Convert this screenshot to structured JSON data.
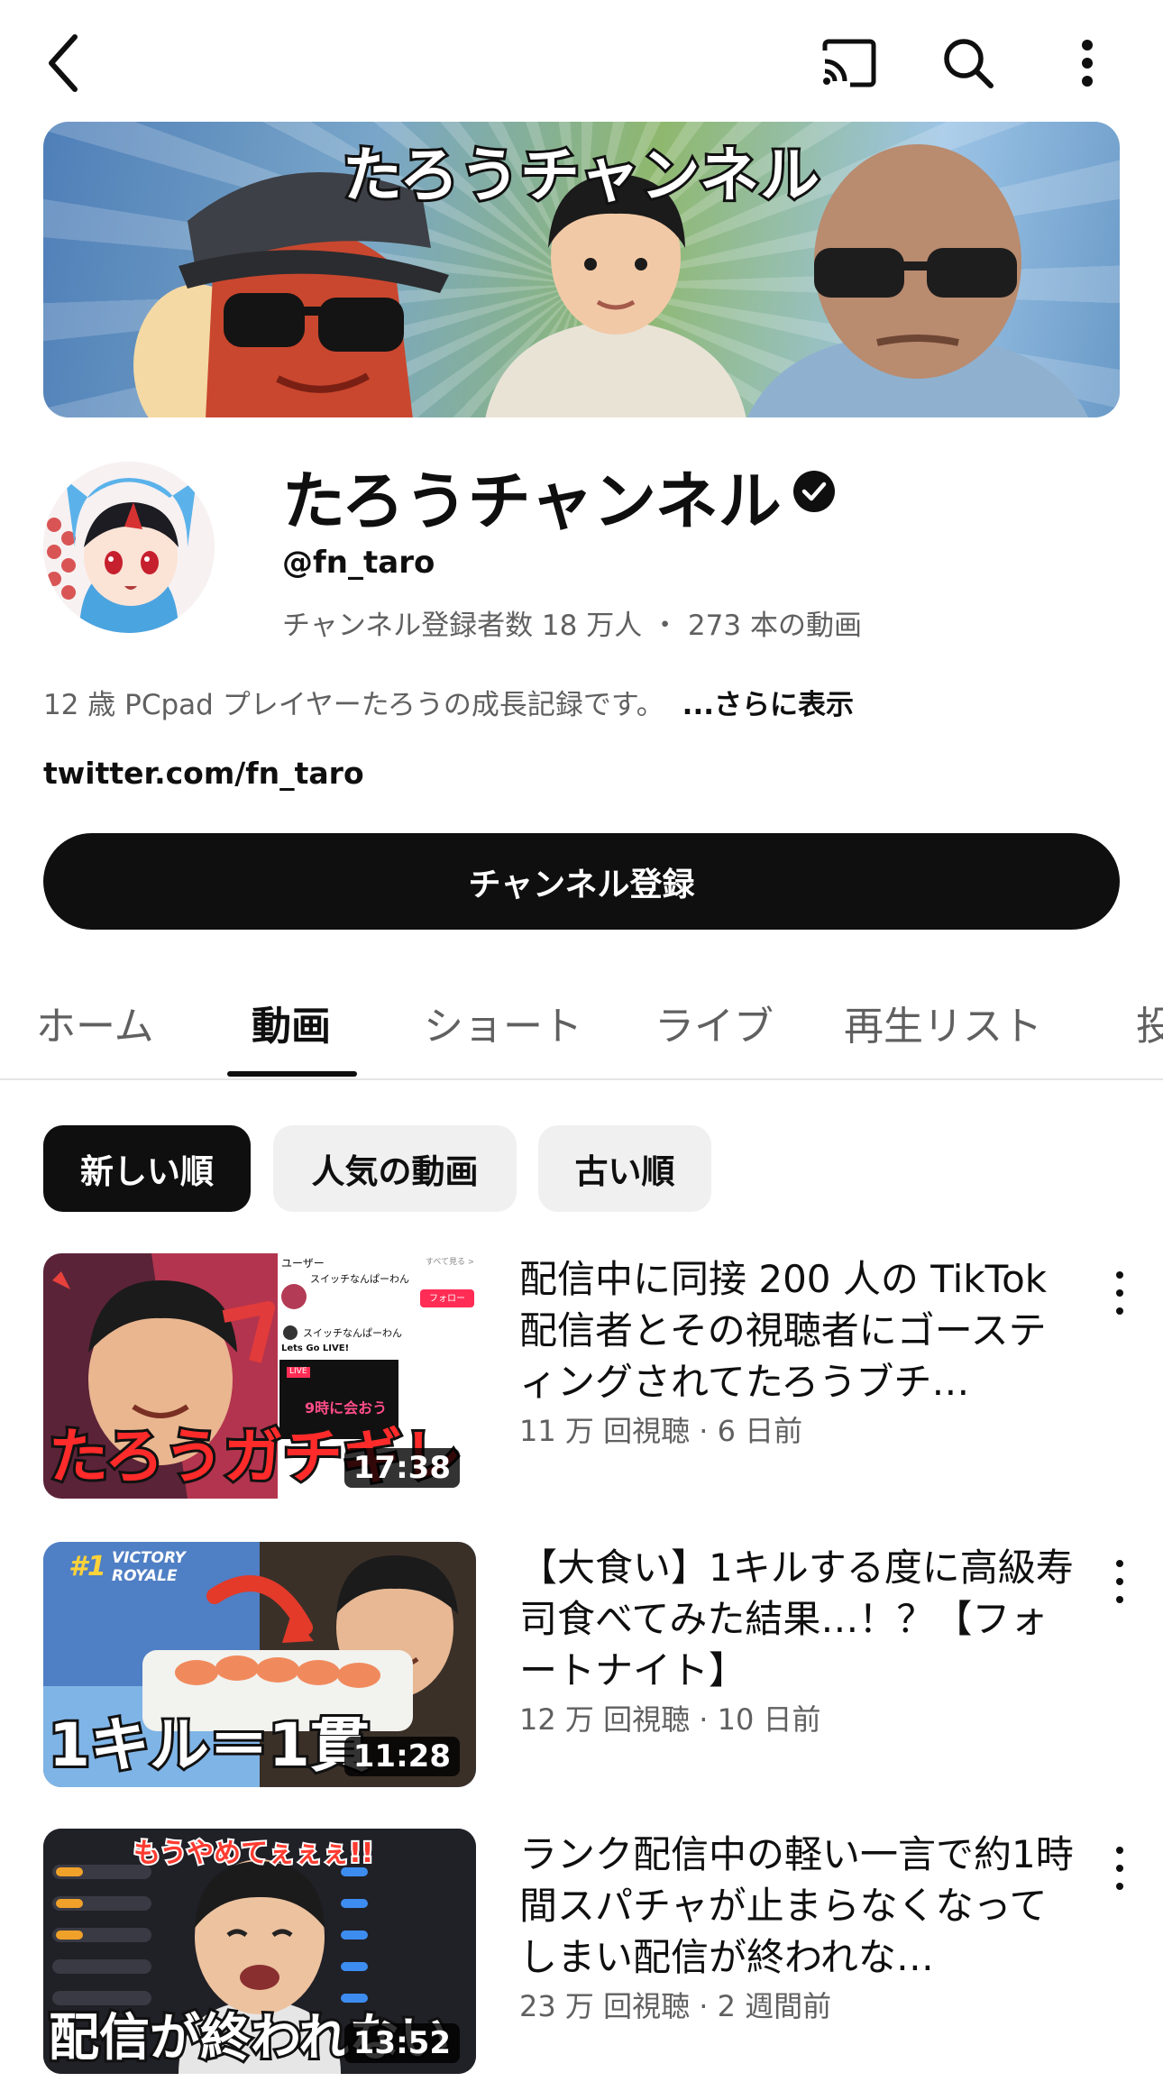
{
  "topbar": {
    "back_icon": "chevron-left-icon",
    "cast_icon": "cast-icon",
    "search_icon": "search-icon",
    "more_icon": "more-vert-icon"
  },
  "banner": {
    "title": "たろうチャンネル"
  },
  "channel": {
    "name": "たろうチャンネル",
    "handle": "@fn_taro",
    "stats": "チャンネル登録者数 18 万人 ・ 273 本の動画",
    "description": "12 歳 PCpad プレイヤーたろうの成長記録です。",
    "more_label": "...さらに表示",
    "link": "twitter.com/fn_taro",
    "subscribe_label": "チャンネル登録"
  },
  "tabs": [
    {
      "label": "ホーム",
      "active": false
    },
    {
      "label": "動画",
      "active": true
    },
    {
      "label": "ショート",
      "active": false
    },
    {
      "label": "ライブ",
      "active": false
    },
    {
      "label": "再生リスト",
      "active": false
    },
    {
      "label": "投",
      "active": false
    }
  ],
  "chips": [
    {
      "label": "新しい順",
      "selected": true
    },
    {
      "label": "人気の動画",
      "selected": false
    },
    {
      "label": "古い順",
      "selected": false
    }
  ],
  "videos": [
    {
      "title": "配信中に同接 200 人の TikTok 配信者とその視聴者にゴースティングされてたろうブチ…",
      "views": "11 万 回視聴 · 6 日前",
      "duration": "17:38",
      "overlay": "たろうガチギレ"
    },
    {
      "title": "【大食い】1キルする度に高級寿司食べてみた結果…！？【フォートナイト】",
      "views": "12 万 回視聴 · 10 日前",
      "duration": "11:28",
      "overlay": "1キル＝1貫"
    },
    {
      "title": "ランク配信中の軽い一言で約1時間スパチャが止まらなくなってしまい配信が終われな…",
      "views": "23 万 回視聴 · 2 週間前",
      "duration": "13:52",
      "overlay": "配信が終われない"
    }
  ],
  "thumb_text": {
    "v1_user": "ユーザー",
    "v1_seeall": "すべて見る >",
    "v1_name1": "スイッチなんぱーわん",
    "v1_follow": "フォロー",
    "v1_name2": "スイッチなんぱーわん",
    "v1_lets": "Lets Go LIVE!",
    "v1_live": "LIVE",
    "v1_meet": "9時に会おう",
    "v2_badge": "VICTORY ROYALE",
    "v2_rank": "#1",
    "v3_top": "もうやめてぇぇぇ!!"
  }
}
